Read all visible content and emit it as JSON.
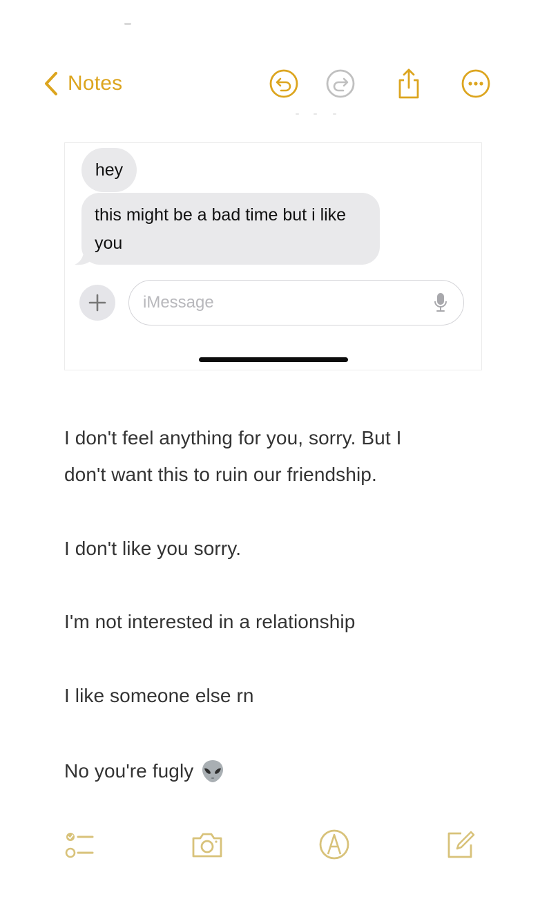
{
  "nav": {
    "back_label": "Notes",
    "icons": [
      "chevron-left-icon",
      "undo-icon",
      "redo-icon",
      "share-icon",
      "more-icon"
    ]
  },
  "screenshot": {
    "messages": [
      {
        "text": "hey"
      },
      {
        "text": "this might be a bad time but i like you"
      }
    ],
    "input_placeholder": "iMessage",
    "icons": [
      "plus-icon",
      "microphone-icon"
    ]
  },
  "note": {
    "paragraph1_line1": "I don't feel anything for you, sorry. But I",
    "paragraph1_line2": "don't want this to ruin our friendship.",
    "line2": "I don't like you sorry.",
    "line3": "I'm not interested in a relationship",
    "line4": "I like someone else rn",
    "line5": "No you're fugly",
    "emoji_icon": "alien-icon"
  },
  "toolbar": {
    "icons": [
      "checklist-icon",
      "camera-icon",
      "markup-icon",
      "compose-icon"
    ]
  },
  "colors": {
    "accent": "#dca51f",
    "redo_disabled": "#c0c0c0",
    "bubble_gray": "#e9e9eb",
    "toolbar_icon": "#d8c27a",
    "text": "#333333"
  }
}
